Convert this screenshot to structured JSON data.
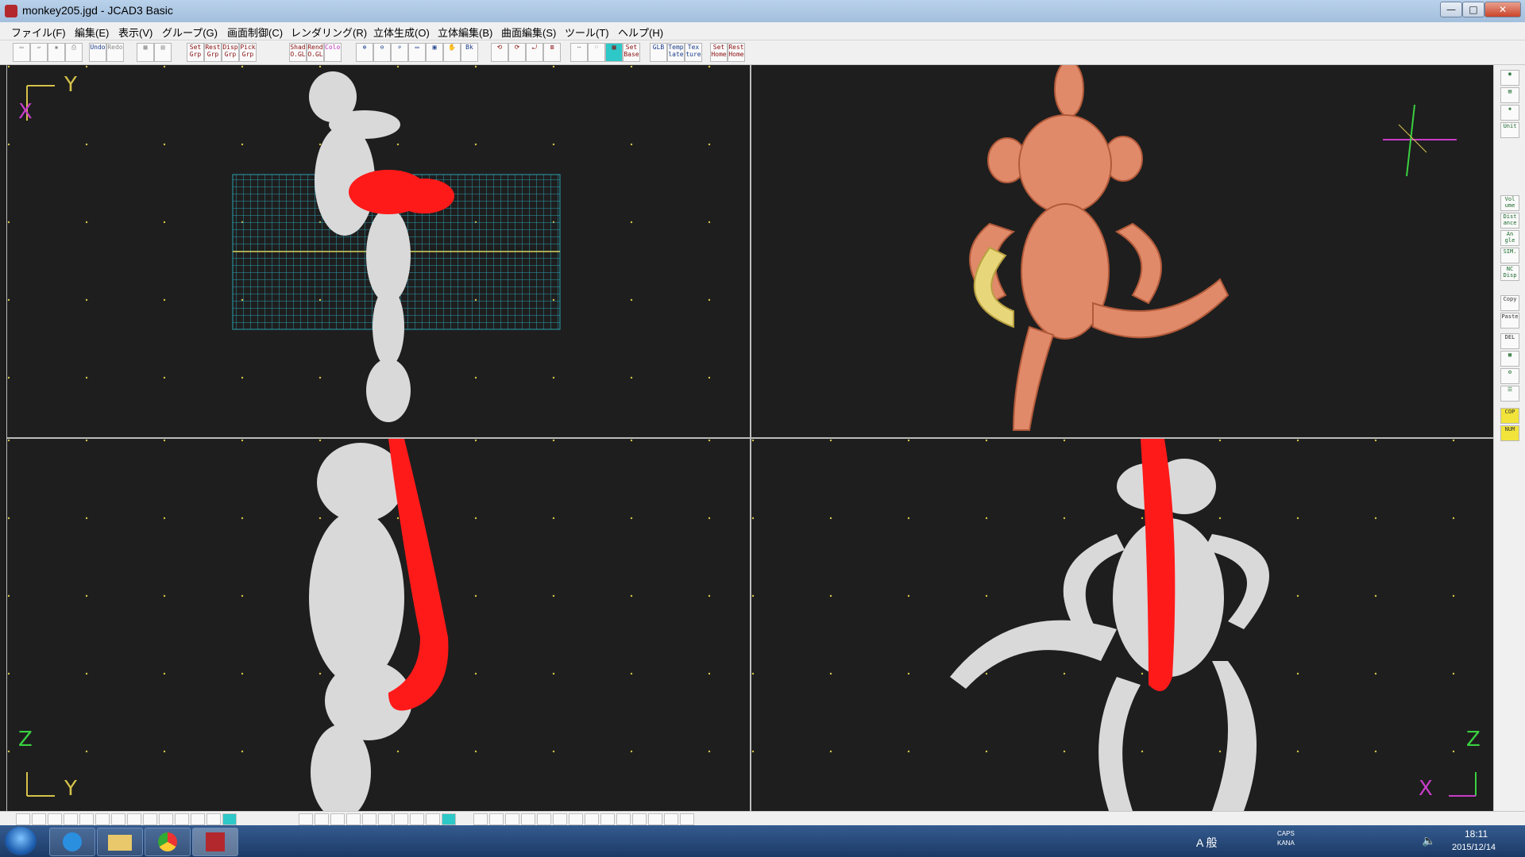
{
  "window": {
    "title": "monkey205.jgd - JCAD3 Basic",
    "min_symbol": "—",
    "max_symbol": "□",
    "close_symbol": "✕"
  },
  "menu": {
    "items": [
      {
        "label": "ファイル(F)"
      },
      {
        "label": "編集(E)"
      },
      {
        "label": "表示(V)"
      },
      {
        "label": "グループ(G)"
      },
      {
        "label": "画面制御(C)"
      },
      {
        "label": "レンダリング(R)"
      },
      {
        "label": "立体生成(O)"
      },
      {
        "label": "立体編集(B)"
      },
      {
        "label": "曲面編集(S)"
      },
      {
        "label": "ツール(T)"
      },
      {
        "label": "ヘルプ(H)"
      }
    ]
  },
  "toolbar": {
    "buttons": [
      {
        "name": "new-file",
        "text": ""
      },
      {
        "name": "open-file",
        "text": ""
      },
      {
        "name": "save-file",
        "text": ""
      },
      {
        "name": "print",
        "text": ""
      },
      {
        "name": "undo",
        "text": "Undo"
      },
      {
        "name": "redo",
        "text": "Redo"
      },
      {
        "name": "view-a",
        "text": ""
      },
      {
        "name": "view-b",
        "text": ""
      },
      {
        "name": "set-grp",
        "text": "Set Grp"
      },
      {
        "name": "rest-grp",
        "text": "Rest Grp"
      },
      {
        "name": "disp-grp",
        "text": "Disp Grp"
      },
      {
        "name": "pick-grp",
        "text": "Pick Grp"
      },
      {
        "name": "shad-ogl",
        "text": "Shad O.GL"
      },
      {
        "name": "rend-ogl",
        "text": "Rend O.GL"
      },
      {
        "name": "color",
        "text": "Color"
      },
      {
        "name": "zoom-in",
        "text": ""
      },
      {
        "name": "zoom-out",
        "text": ""
      },
      {
        "name": "zoom-fit",
        "text": ""
      },
      {
        "name": "zoom-window",
        "text": ""
      },
      {
        "name": "zoom-all",
        "text": ""
      },
      {
        "name": "pan",
        "text": ""
      },
      {
        "name": "bk",
        "text": "Bk"
      },
      {
        "name": "rot-a",
        "text": ""
      },
      {
        "name": "rot-b",
        "text": ""
      },
      {
        "name": "rot-c",
        "text": ""
      },
      {
        "name": "rot-d",
        "text": ""
      },
      {
        "name": "grid-a",
        "text": ""
      },
      {
        "name": "grid-b",
        "text": ""
      },
      {
        "name": "grid-c",
        "text": ""
      },
      {
        "name": "set-base",
        "text": "Set Base"
      },
      {
        "name": "glb",
        "text": "GLB"
      },
      {
        "name": "temp-late",
        "text": "Temp late"
      },
      {
        "name": "tex-ture",
        "text": "Tex ture"
      },
      {
        "name": "set-home",
        "text": "Set Home"
      },
      {
        "name": "rest-home",
        "text": "Rest Home"
      }
    ]
  },
  "viewports": {
    "top_left": {
      "axis_v": "Y",
      "axis_h": "X"
    },
    "top_right": {},
    "bottom_left": {
      "axis_v": "Z",
      "axis_h": "Y"
    },
    "bottom_right": {
      "axis_v": "Z",
      "axis_h": "X"
    }
  },
  "right_toolbar": {
    "buttons": [
      {
        "name": "view-btn-1",
        "text": ""
      },
      {
        "name": "view-btn-2",
        "text": ""
      },
      {
        "name": "view-btn-3",
        "text": ""
      },
      {
        "name": "unit",
        "text": "Unit"
      },
      {
        "name": "volume",
        "text": "Vol ume"
      },
      {
        "name": "distance",
        "text": "Dist ance"
      },
      {
        "name": "angle",
        "text": "An gle"
      },
      {
        "name": "sim",
        "text": "SIM."
      },
      {
        "name": "nc-disp",
        "text": "NC Disp"
      },
      {
        "name": "copy",
        "text": "Copy"
      },
      {
        "name": "paste",
        "text": "Paste"
      },
      {
        "name": "delete",
        "text": "DEL"
      },
      {
        "name": "tool-a",
        "text": ""
      },
      {
        "name": "tool-b",
        "text": ""
      },
      {
        "name": "tool-c",
        "text": ""
      },
      {
        "name": "cop",
        "text": "COP"
      },
      {
        "name": "num",
        "text": "NUM"
      }
    ]
  },
  "taskbar": {
    "time": "18:11",
    "date": "2015/12/14",
    "ime": "A 般",
    "caps": "CAPS",
    "kana": "KANA"
  },
  "colors": {
    "viewport_bg": "#1e1e1e",
    "wireframe": "#d9d9d9",
    "selected": "#ff1a1a",
    "grid_plane": "#2b9fb0",
    "render": "#e08a6a",
    "axis": "#d6c24a",
    "axis_label_x": "#c83cc8",
    "axis_label_y": "#d6c24a"
  }
}
